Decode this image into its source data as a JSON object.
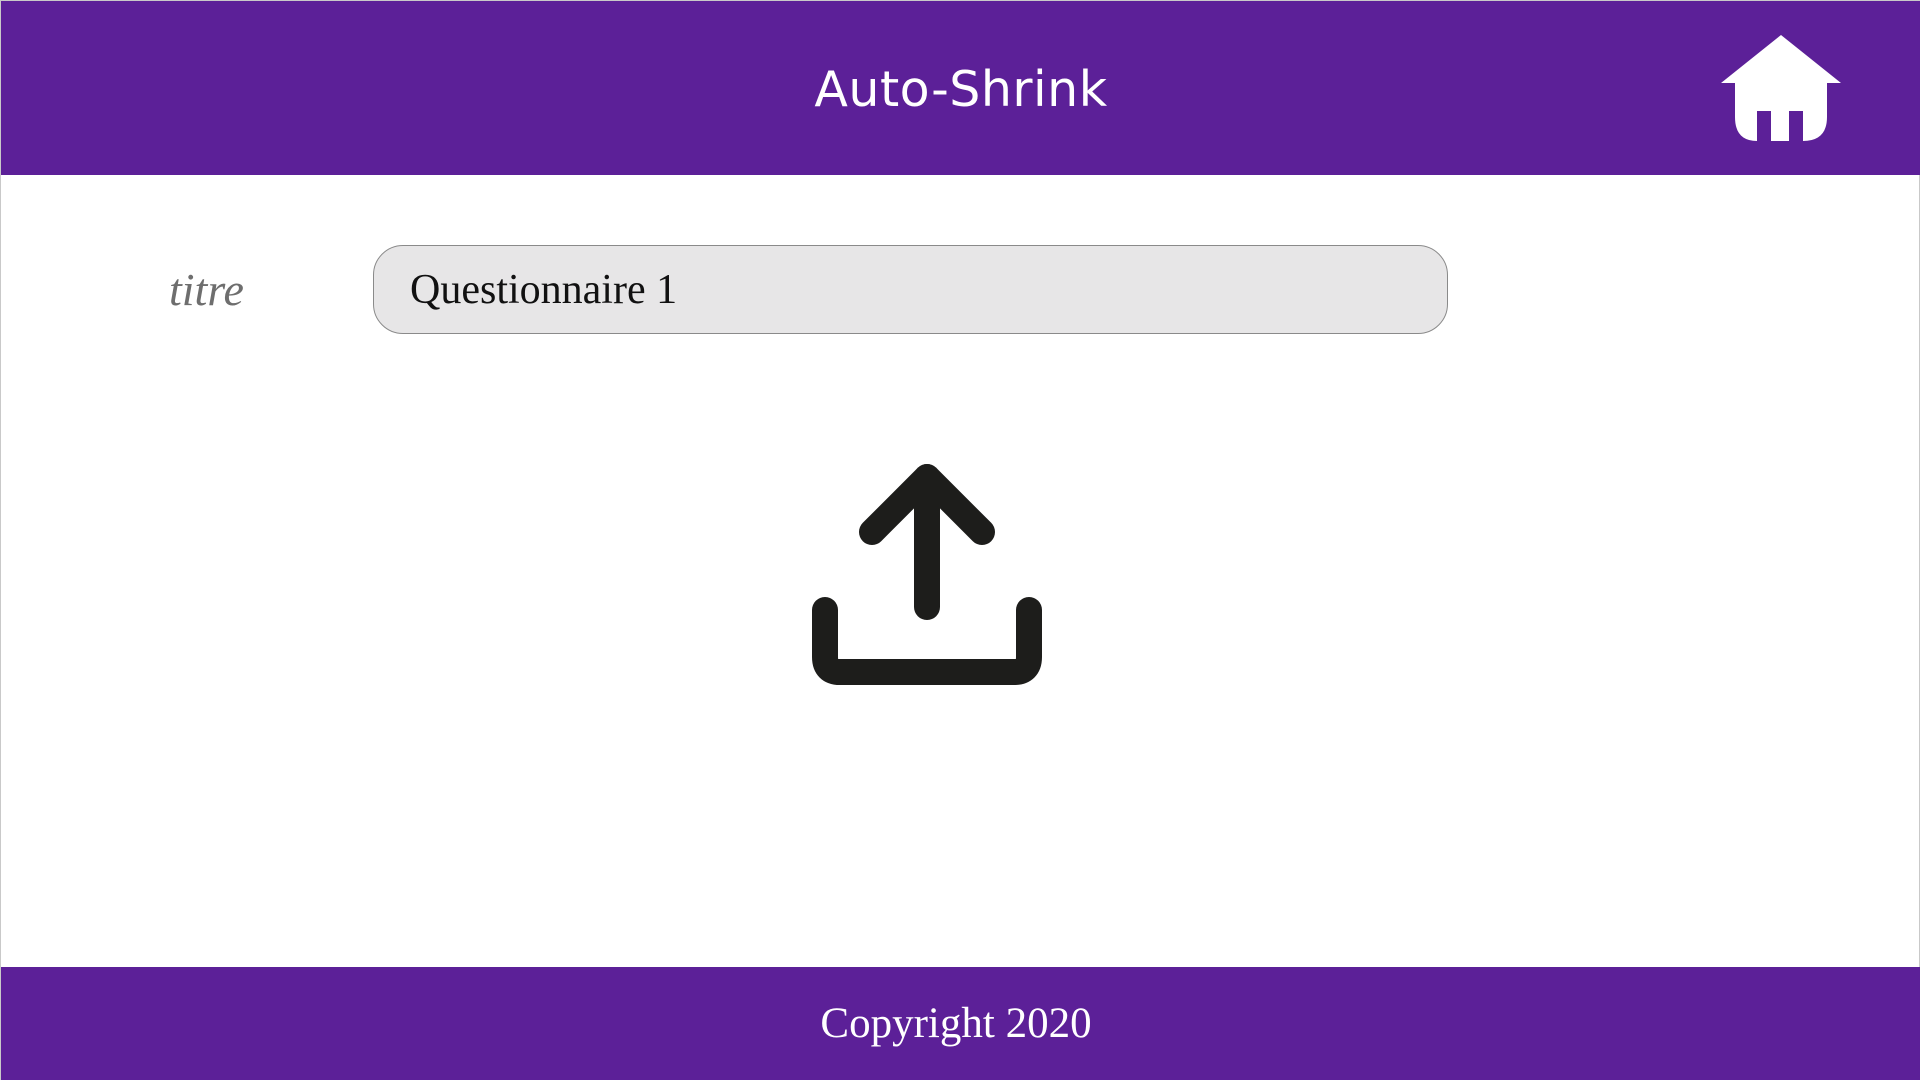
{
  "header": {
    "title": "Auto-Shrink",
    "home_icon": "home-icon",
    "background_color": "#5c2098",
    "text_color": "#ffffff"
  },
  "form": {
    "title_label": "titre",
    "title_value": "Questionnaire 1"
  },
  "upload": {
    "icon": "upload-icon",
    "icon_color": "#1d1d1b"
  },
  "footer": {
    "copyright": "Copyright 2020",
    "background_color": "#5c2098"
  }
}
